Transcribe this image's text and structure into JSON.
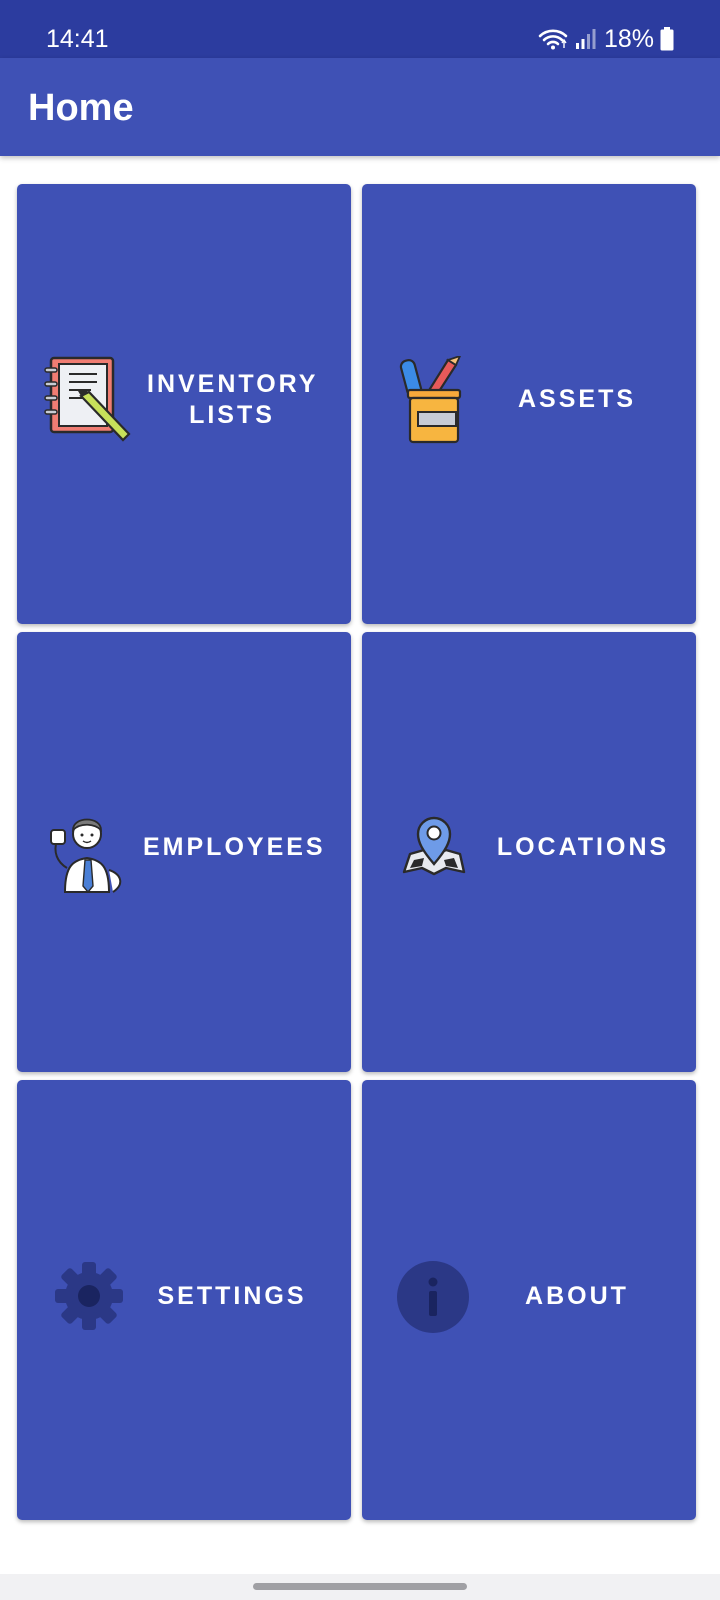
{
  "status_bar": {
    "time": "14:41",
    "battery": "18%",
    "icons": [
      "wifi-icon",
      "signal-icon",
      "battery-icon"
    ]
  },
  "app_bar": {
    "title": "Home"
  },
  "tiles": [
    {
      "label": "INVENTORY\nLISTS",
      "icon": "notebook-pencil-icon"
    },
    {
      "label": "ASSETS",
      "icon": "pencil-cup-icon"
    },
    {
      "label": "EMPLOYEES",
      "icon": "employee-icon"
    },
    {
      "label": "LOCATIONS",
      "icon": "map-pin-icon"
    },
    {
      "label": "SETTINGS",
      "icon": "gear-icon"
    },
    {
      "label": "ABOUT",
      "icon": "info-icon"
    }
  ],
  "colors": {
    "primary": "#3f51b5",
    "primary_dark": "#2c3c9f",
    "icon_dim": "#2b3886",
    "on_primary": "#ffffff"
  }
}
